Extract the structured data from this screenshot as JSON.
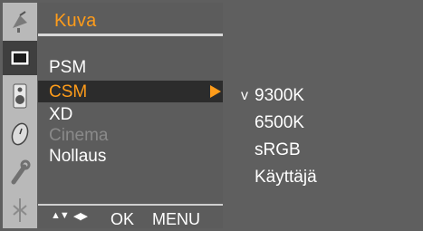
{
  "menu": {
    "title": "Kuva",
    "items": [
      {
        "label": "PSM"
      },
      {
        "label": "CSM"
      },
      {
        "label": "XD"
      },
      {
        "label": "Cinema"
      },
      {
        "label": "Nollaus"
      }
    ]
  },
  "submenu": {
    "check_mark": "v",
    "options": [
      {
        "label": "9300K"
      },
      {
        "label": "6500K"
      },
      {
        "label": "sRGB"
      },
      {
        "label": "Käyttäjä"
      }
    ]
  },
  "bottom_bar": {
    "updown_symbol": "▲▼",
    "leftright_symbol": "◀▶",
    "ok_label": "OK",
    "menu_label": "MENU"
  },
  "colors": {
    "accent": "#ff9c1a",
    "panel": "#5c5c5c",
    "highlight": "#2c2c2c",
    "icon_strip": "#b9b9b9"
  },
  "icons": [
    "satellite-dish-icon",
    "picture-icon",
    "speaker-icon",
    "clock-icon",
    "wrench-icon",
    "antenna-icon"
  ]
}
